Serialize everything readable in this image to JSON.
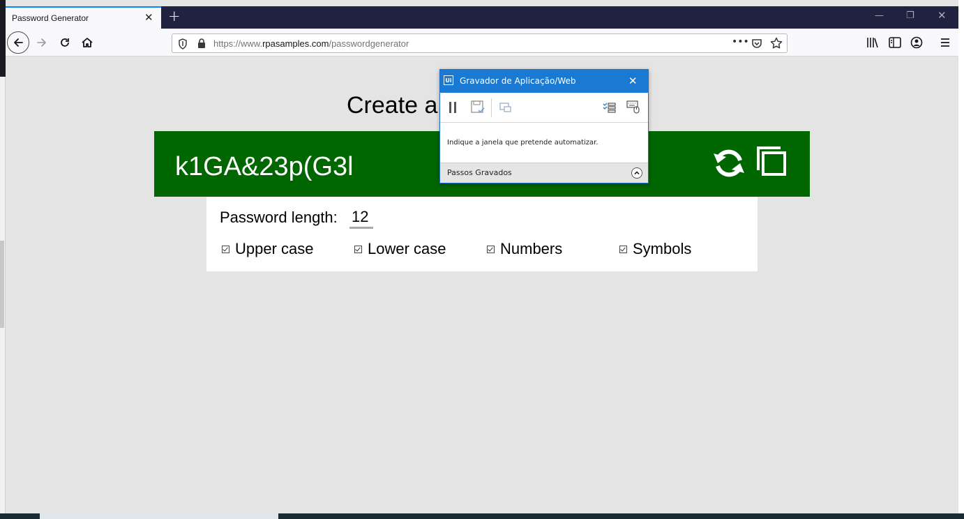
{
  "browser": {
    "tab_title": "Password Generator",
    "url_scheme_www": "https://www.",
    "url_domain": "rpasamples.com",
    "url_path": "/passwordgenerator",
    "overflow_label": "•••"
  },
  "page": {
    "heading": "Create a",
    "password": "k1GA&23p(G3l",
    "length_label": "Password length:",
    "length_value": "12",
    "options": [
      {
        "label": "Upper case",
        "checked": true
      },
      {
        "label": "Lower case",
        "checked": true
      },
      {
        "label": "Numbers",
        "checked": true
      },
      {
        "label": "Symbols",
        "checked": true
      }
    ]
  },
  "recorder": {
    "logo": "Ui",
    "title": "Gravador de Aplicação/Web",
    "message": "Indique a janela que pretende automatizar.",
    "footer": "Passos Gravados"
  },
  "colors": {
    "password_bar": "#006600",
    "recorder_title": "#1a79d3",
    "browser_titlebar": "#202340"
  }
}
